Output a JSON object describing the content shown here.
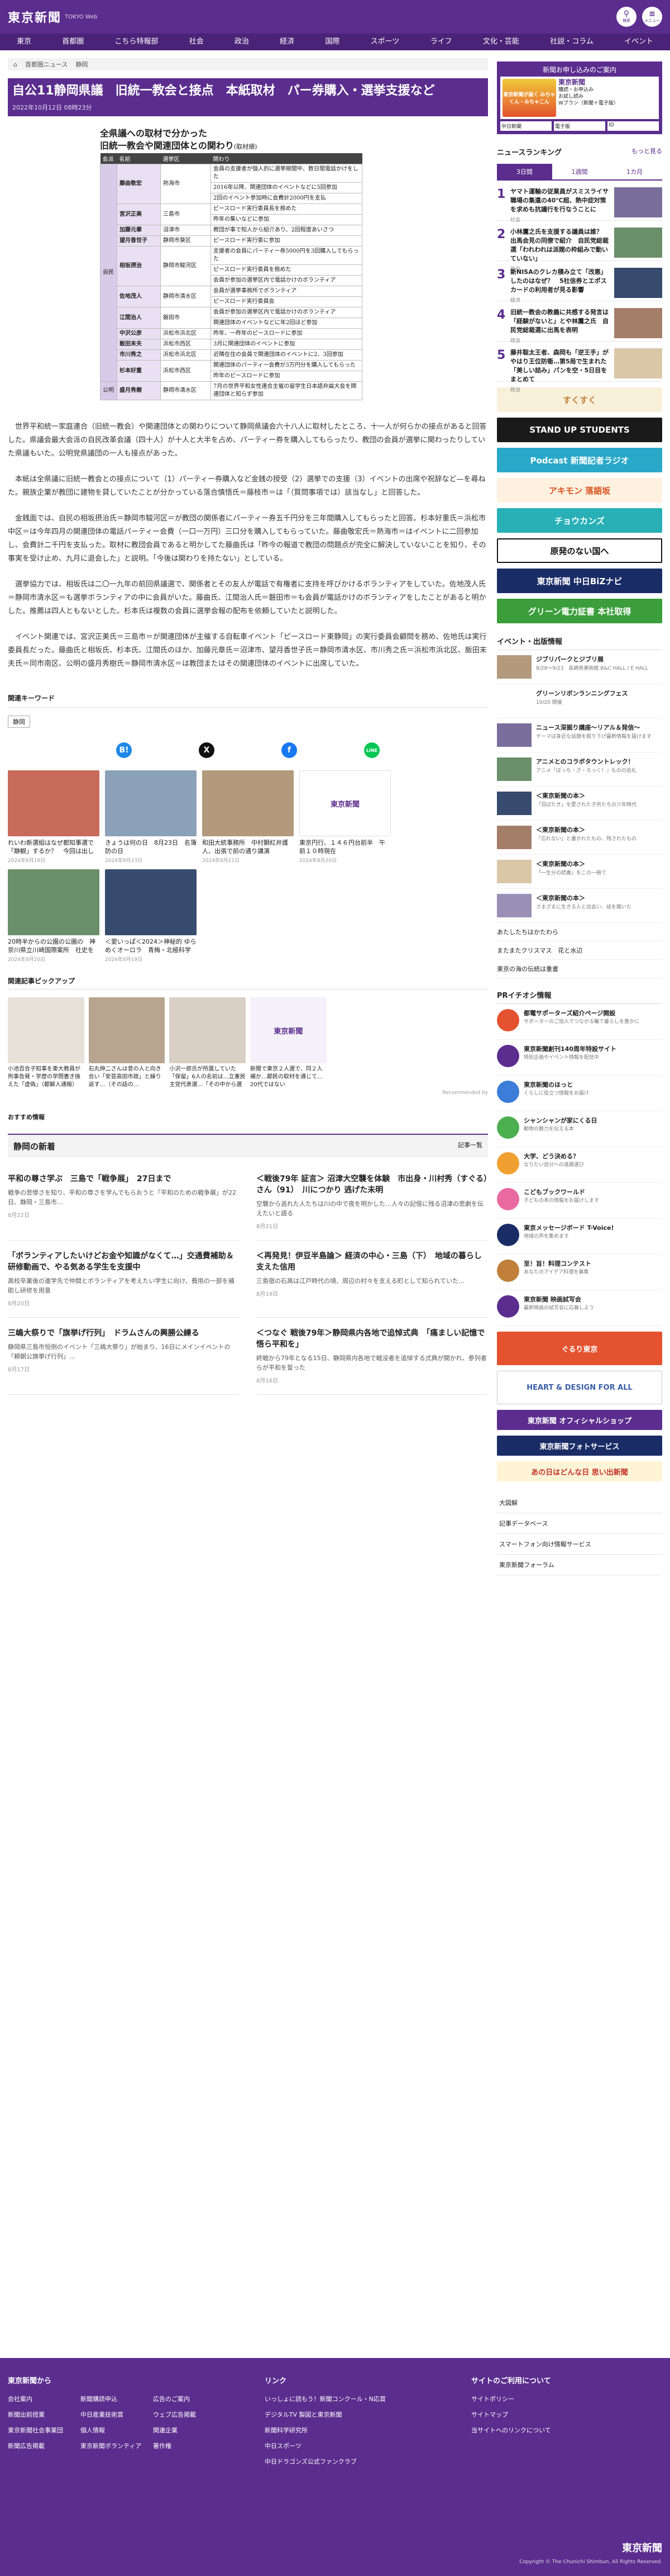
{
  "header": {
    "logo": "東京新聞",
    "logo_sub": "TOKYO Web",
    "search_label": "検索",
    "menu_label": "メニュー"
  },
  "nav": [
    "東京",
    "首都圏",
    "こちら特報部",
    "社会",
    "政治",
    "経済",
    "国際",
    "スポーツ",
    "ライフ",
    "文化・芸能",
    "社説・コラム",
    "イベント"
  ],
  "breadcrumb": [
    "首都圏ニュース",
    "静岡"
  ],
  "article": {
    "title": "自公11静岡県議　旧統一教会と接点　本紙取材　パー券購入・選挙支援など",
    "date": "2022年10月12日 08時23分",
    "figure_title_1": "全県議への取材で分かった",
    "figure_title_2": "旧統一教会や関連団体との関わり",
    "figure_source": "(取材順)",
    "figure_headers": [
      "会派",
      "名前",
      "選挙区",
      "関わり"
    ],
    "figure_groups": [
      {
        "party": "自民",
        "rows": [
          {
            "name": "藤曲敬宏",
            "area": "熱海市",
            "items": [
              "会員の支援者が個人的に選挙期間中、数日間電話かけをした",
              "2016年以降、関連団体のイベントなどに5回参加",
              "2回のイベント参加時に会費計2000円を支払"
            ]
          },
          {
            "name": "宮沢正美",
            "area": "三島市",
            "items": [
              "ピースロード実行委員長を務めた",
              "昨年の集いなどに参加"
            ]
          },
          {
            "name": "加藤元章",
            "area": "沼津市",
            "items": [
              "教団が事で知人から紹介あり、2回程度あいさつ"
            ]
          },
          {
            "name": "望月香世子",
            "area": "静岡市葵区",
            "items": [
              "ピースロード実行委に参加"
            ]
          },
          {
            "name": "相坂摂治",
            "area": "静岡市駿河区",
            "items": [
              "支援者の会員にパーティー券5000円を3回購入してもらった",
              "ピースロード実行委員を務めた",
              "会員が参加の選挙区内で電話かけのボランティア"
            ]
          },
          {
            "name": "佐地茂人",
            "area": "静岡市清水区",
            "items": [
              "会員が選挙事務所でボランティア",
              "ピースロード実行委員会"
            ]
          },
          {
            "name": "江間治人",
            "area": "磐田市",
            "items": [
              "会員が参加の選挙区内で電話かけのボランティア",
              "関連団体のイベントなどに年2回ほど参加"
            ]
          },
          {
            "name": "中沢公彦",
            "area": "浜松市浜北区",
            "items": [
              "昨年、一昨年のピースロードに参加"
            ]
          },
          {
            "name": "飯田末夫",
            "area": "浜松市西区",
            "items": [
              "3月に関連団体のイベントに参加"
            ]
          },
          {
            "name": "市川秀之",
            "area": "浜松市浜北区",
            "items": [
              "近隣在住の会員で関連団体のイベントに2、3回参加"
            ]
          },
          {
            "name": "杉本好重",
            "area": "浜松市西区",
            "items": [
              "関連団体のパーティー会費が3万円分を購入してもらった",
              "昨年のピースロードに参加"
            ]
          }
        ]
      },
      {
        "party": "公明",
        "rows": [
          {
            "name": "盛月秀樹",
            "area": "静岡市清水区",
            "items": [
              "7月の世界平和女性連合主催の留学生日本語弁論大会を関連団体と知らず参加"
            ]
          }
        ]
      }
    ],
    "paragraphs": [
      "世界平和統一家庭連合（旧統一教会）や関連団体との関わりについて静岡県議会六十八人に取材したところ、十一人が何らかの接点があると回答した。県議会最大会派の自民改革会議（四十人）が十人と大半を占め、パーティー券を購入してもらったり、教団の会員が選挙に関わったりしていた県議もいた。公明党県議団の一人も接点があった。",
      "本紙は全県議に旧統一教会との接点について（1）パーティー券購入など金銭の授受（2）選挙での支援（3）イベントの出席や祝辞など—を尋ねた。親族企業が教団に建物を貸していたことが分かっている落合慎悟氏＝藤枝市＝は「（質問事項では）該当なし」と回答した。",
      "金銭面では、自民の相坂摂治氏＝静岡市駿河区＝が教団の関係者にパーティー券五千円分を三年間購入してもらったと回答。杉本好重氏＝浜松市中区＝は今年四月の関連団体の電話パーティー会費（一口一万円）三口分を購入してもらっていた。藤曲敬宏氏＝熱海市＝はイベントに二回参加し、会費計二千円を支払った。取材に教団会員であると明かしてた藤曲氏は「昨今の報道で教団の問題点が完全に解決していないことを知り、その事実を受け止め、九月に退会した」と説明。「今後は関わりを持たない」としている。",
      "選挙協力では、相坂氏は二〇一九年の前回県議選で、関係者とその友人が電話で有権者に支持を呼びかけるボランティアをしていた。佐地茂人氏＝静岡市清水区＝も選挙ボランティアの中に会員がいた。藤曲氏、江間治人氏＝磐田市＝も会員が電話かけのボランティアをしたことがあると明かした。推薦は四人ともないとした。杉本氏は複数の会員に選挙会報の配布を依頼していたと説明した。",
      "イベント関連では、宮沢正美氏＝三島市＝が関連団体が主催する自転車イベント「ピースロード東静岡」の実行委員会顧問を務め、佐地氏は実行委員長だった。藤曲氏と相坂氏、杉本氏、江間氏のほか、加藤元章氏＝沼津市、望月香世子氏＝静岡市清水区、市川秀之氏＝浜松市浜北区、飯田末夫氏＝同市南区、公明の盛月秀樹氏＝静岡市清水区＝は教団またはその関連団体のイベントに出席していた。"
    ],
    "keyword_label": "関連キーワード",
    "keyword": "静岡",
    "share_icons": [
      "B!",
      "X",
      "f",
      "LINE"
    ]
  },
  "related_cards": [
    {
      "cap": "れいわ新選組はなぜ都知事選で「静観」するか？　今回は出したい比較候補者の「小池百合…",
      "date": "2024年6月18日"
    },
    {
      "cap": "きょうは何の日　8月23日　名簿防の日",
      "date": "2024年8月23日"
    },
    {
      "cap": "和田大統事務所　中村獅紅弁護人、出張で前の通り講演",
      "date": "2024年8月21日"
    },
    {
      "cap": "東京円行、１４６円台前半　午前１０時現在",
      "date": "2024年8月20日"
    },
    {
      "cap": "",
      "date": ""
    },
    {
      "cap": "20時半からの公園の公園の　神奈川県立川崎国際案所　社史を更行に",
      "date": "2024年8月20日"
    },
    {
      "cap": "＜愛いっぱ＜2024＞神秘的 ゆらめくオーロラ　青梅・北極科学館（立川市）",
      "date": "2024年8月19日"
    }
  ],
  "pickup": {
    "title": "関連記事ピックアップ",
    "cards": [
      "小池百合子知事を東大教員が刑事告発・学歴の学問書き換えた「虚偽」（都解人通報）",
      "石丸伸二さんは昔の人と向き合い「安芸高田市政」と繰り返す…（その話の…",
      "小沢一郎氏が所属していた「保留」6人の名前は…立憲民主党代表選…「その中から選ぶ」",
      "新聞で東京２人選で、同２人補か…都民の取材を通じて… 20代ではない",
      "",
      ""
    ],
    "rec": "Recommended by"
  },
  "osusume": "おすすめ情報",
  "local": {
    "title": "静岡の新着",
    "more": "記事一覧",
    "items": [
      {
        "t": "平和の尊さ学ぶ　三島で「戦争展」　27日まで",
        "s": "戦争の悲惨さを知り、平和の尊さを学んでもらおうと「平和のための戦争展」が22日、静岡・三島市…",
        "d": "8月22日"
      },
      {
        "t": "＜戦後79年 証言＞ 沼津大空襲を体験　市出身・川村秀（すぐる）さん（91）　川につかり 逃げた未明",
        "s": "空襲から逃れた人たちは川の中で夜を明かした…人々の記憶に残る沼津の悲劇を伝えたいと語る",
        "d": "8月21日"
      },
      {
        "t": "「ボランティアしたいけどお金や知識がなくて…」交通費補助＆研修動画で、やる気ある学生を支援中",
        "s": "高校卒業後の進学先で仲間とボランティアを考えたい学生に向け、費用の一部を補助し研修を用意",
        "d": "8月20日"
      },
      {
        "t": "＜再発見！伊豆半島論＞ 経済の中心・三島（下）　地域の暮らし支えた信用",
        "s": "三島宿の石高は江戸時代の頃、周辺の村々を支える町として知られていた…",
        "d": "8月19日"
      },
      {
        "t": "三嶋大祭りで「旗挙げ行列」　ドラムさんの興勝公練る",
        "s": "静岡県三島市恒例のイベント「三嶋大祭り」が始まり、16日にメインイベントの「頼朝公旗挙げ行列」…",
        "d": "8月17日"
      },
      {
        "t": "＜つなぐ 戦後79年＞静岡県内各地で追悼式典　「痛ましい記憶で悟ら平和を」",
        "s": "終戦から79年となる15日、静岡県内各地で戦没者を追悼する式典が開かれ、参列者らが平和を誓った",
        "d": "8月16日"
      }
    ]
  },
  "side": {
    "ad_title": "新聞お申し込みのご案内",
    "ad_block": "東京新聞が届く みちゃくん・みちゃこん",
    "ad_lines": [
      "東京新聞",
      "購読・お申込み",
      "お試し読み",
      "Wプラン（新聞＋電子版）"
    ],
    "ad_row2": [
      "中日新聞",
      "電子版",
      "ID"
    ],
    "ranking_title": "ニュースランキング",
    "ranking_more": "もっと見る",
    "tabs": [
      "3日間",
      "1週間",
      "1カ月"
    ],
    "ranks": [
      {
        "n": "1",
        "t": "ヤマト運輸の従業員がスミスライサ　職場の集遺の40℃超、熱中症対策を求めも抗議行を行なうことに",
        "c": "社会"
      },
      {
        "n": "2",
        "t": "小林鷹之氏を支援する議員は誰？　出馬会見の同僚で紹介　自民党総裁選「われわれは派閥の枠組みで動いていない」",
        "c": "政治"
      },
      {
        "n": "3",
        "t": "新NISAのクレカ積み立て「改悪」したのはなぜ？　5社信券とエポスカードの利用者が見る影響",
        "c": "経済"
      },
      {
        "n": "4",
        "t": "旧統一教会の教義に共感する発言は「経験がないと」とや林鷹之氏　自民党総裁選に出馬を表明",
        "c": "政治"
      },
      {
        "n": "5",
        "t": "藤井聡太王者、森岡も「逆王手」がやはり王位防衛…第5局で生まれた「美しい詰み」パンを空・5日目をまとめて",
        "c": "政治"
      }
    ],
    "banners": [
      "すくすく",
      "STAND UP STUDENTS",
      "Podcast 新聞記者ラジオ",
      "アキモン 落語坂",
      "チョウカンズ",
      "原発のない国へ",
      "東京新聞 中日BiZナビ",
      "グリーン電力証書 本社取得"
    ],
    "event_title": "イベント・出版情報",
    "events": [
      {
        "t": "ジブリパークとジブリ展",
        "s": "8/28〜9/23　長崎県美術館 B&C HALL / E HALL"
      },
      {
        "t": "グリーンリボンランニングフェス",
        "s": "10/20 開催"
      },
      {
        "t": "ニュース深掘り講座〜リアル＆発信〜",
        "s": "テーマは身近な話題を掘り下げ最新情報を届けます"
      },
      {
        "t": "アニメとのコラボタウントレック！",
        "s": "アニメ『ぼっち・ざ・ろっく！』ものの巡礼"
      },
      {
        "t": "＜東京新聞の本＞",
        "s": "「羽ばたき」を愛された子供たちの少年時代"
      },
      {
        "t": "＜東京新聞の本＞",
        "s": "「忘れない」と書かれたもの、残されたもの"
      },
      {
        "t": "＜東京新聞の本＞",
        "s": "「一生分の読書」をこの一冊で"
      },
      {
        "t": "＜東京新聞の本＞",
        "s": "さまざまに生きる人と出会い、話を聞いた"
      }
    ],
    "ev_small": [
      "あたしたちはかたわら",
      "またまたクリスマス　花と水辺",
      "東京の海の伝統は重書"
    ],
    "pr_title": "PRイチオシ情報",
    "prs": [
      {
        "t": "都電サポーターズ紹介ページ開設",
        "s": "サポーターのご加入でつながる輪で暮らしを豊かに"
      },
      {
        "t": "東京新聞創刊140周年特設サイト",
        "s": "特別企画やイベント情報を配信中"
      },
      {
        "t": "東京新聞のほっと",
        "s": "くらしに役立つ情報をお届け"
      },
      {
        "t": "シャンシャンが家にくる日",
        "s": "動物の魅力を伝える本"
      },
      {
        "t": "大学、どう決める？",
        "s": "なりたい自分への進路選び"
      },
      {
        "t": "こどもブックワールド",
        "s": "子どもの本の情報をお届けします"
      },
      {
        "t": "東京メッセージボード T-Voice!",
        "s": "地域の声を集めます"
      },
      {
        "t": "至！旨！料理コンテスト",
        "s": "あなたのアイデア料理を募集"
      },
      {
        "t": "東京新聞 映画試写会",
        "s": "最新映画の試写会に応募しよう"
      }
    ],
    "side_banners": [
      "ぐるり東京",
      "HEART & DESIGN FOR ALL",
      "東京新聞 オフィシャルショップ",
      "東京新聞フォトサービス",
      "あの日はどんな日 思い出新聞"
    ],
    "links": [
      "大図解",
      "記事データベース",
      "スマートフォン向け情報サービス",
      "東京新聞フォーラム"
    ]
  },
  "footer": {
    "col1_title": "東京新聞から",
    "col1": [
      "会社案内",
      "新聞購読申込",
      "広告のご案内",
      "新聞出前授業",
      "中日産業技術賞",
      "ウェブ広告掲載",
      "東京新聞社会事業団",
      "個人情報",
      "関連企業",
      "新聞広告掲載",
      "東京新聞ボランティア",
      "著作権"
    ],
    "col2_title": "リンク",
    "col2": [
      "いっしょに読もう！新聞コンクール・N応賞",
      "デジタルTV 製図と東京新聞",
      "新聞科学研究所",
      "中日スポーツ",
      "中日ドラゴンズ公式ファンクラブ"
    ],
    "col3_title": "サイトのご利用について",
    "col3": [
      "サイトポリシー",
      "サイトマップ",
      "当サイトへのリンクについて"
    ],
    "copyright": "Copyright © The Chunichi Shimbun, All Rights Reserved."
  }
}
